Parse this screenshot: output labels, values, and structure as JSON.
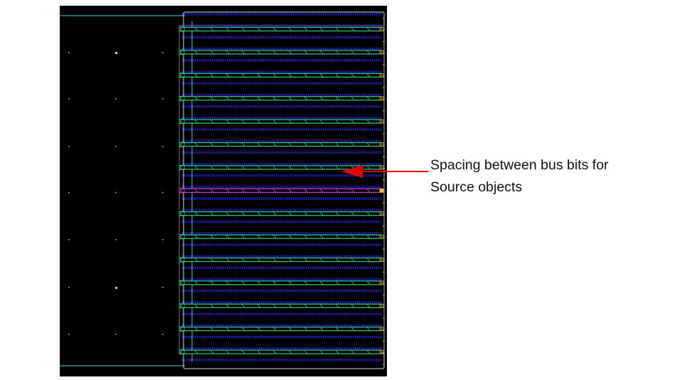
{
  "annotation": {
    "line1": "Spacing between bus bits for",
    "line2": "Source objects"
  },
  "colors": {
    "canvas": "#000000",
    "boundary": "#2fd3d3",
    "outline": "#d8d8d8",
    "bus_bit": "#2fd07a",
    "highlighted_bit": "#d03ad8",
    "spacing_fill": "#1f1fd8",
    "pin": "#e8a020",
    "arrow": "#e00000"
  },
  "layout": {
    "bus_bit_count": 15,
    "highlighted_bit_index": 7
  },
  "icons": {
    "arrow": "left-pointing-arrow-icon"
  }
}
